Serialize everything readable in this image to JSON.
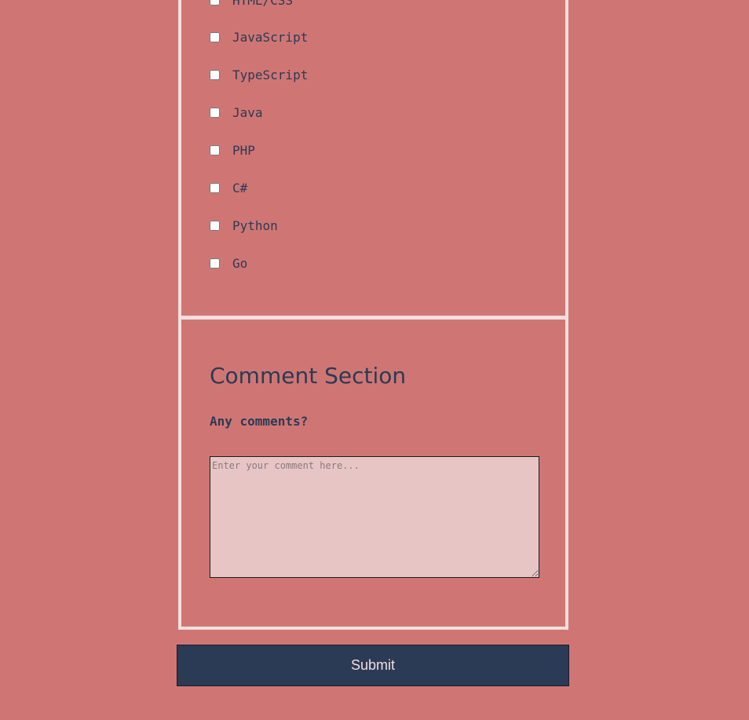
{
  "languages": {
    "items": [
      {
        "label": "HTML/CSS",
        "checked": false
      },
      {
        "label": "JavaScript",
        "checked": false
      },
      {
        "label": "TypeScript",
        "checked": false
      },
      {
        "label": "Java",
        "checked": false
      },
      {
        "label": "PHP",
        "checked": false
      },
      {
        "label": "C#",
        "checked": false
      },
      {
        "label": "Python",
        "checked": false
      },
      {
        "label": "Go",
        "checked": false
      }
    ]
  },
  "comment_section": {
    "title": "Comment Section",
    "question": "Any comments?",
    "textarea_placeholder": "Enter your comment here...",
    "textarea_value": ""
  },
  "actions": {
    "submit_label": "Submit"
  },
  "colors": {
    "background": "#cf7674",
    "panel_border": "#f4dede",
    "text": "#2b3a55",
    "textarea_bg": "#e8c5c5",
    "button_bg": "#2b3a55",
    "button_text": "#f4dede"
  }
}
